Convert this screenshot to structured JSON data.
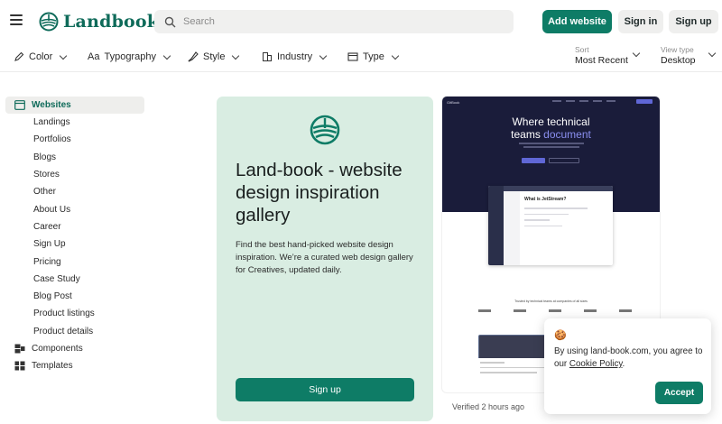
{
  "header": {
    "logo_text": "Landbook",
    "search_placeholder": "Search",
    "add_website_label": "Add website",
    "sign_in_label": "Sign in",
    "sign_up_label": "Sign up"
  },
  "filters": {
    "items": [
      {
        "label": "Color",
        "icon": "pen-icon"
      },
      {
        "label": "Typography",
        "icon": "typography-icon"
      },
      {
        "label": "Style",
        "icon": "brush-icon"
      },
      {
        "label": "Industry",
        "icon": "building-icon"
      },
      {
        "label": "Type",
        "icon": "window-icon"
      }
    ],
    "sort_label": "Sort",
    "sort_value": "Most Recent",
    "view_label": "View type",
    "view_value": "Desktop"
  },
  "sidebar": {
    "active": "Websites",
    "sub_items": [
      "Landings",
      "Portfolios",
      "Blogs",
      "Stores",
      "Other",
      "About Us",
      "Career",
      "Sign Up",
      "Pricing",
      "Case Study",
      "Blog Post",
      "Product listings",
      "Product details"
    ],
    "components_label": "Components",
    "templates_label": "Templates"
  },
  "hero": {
    "title": "Land-book - website design inspiration gallery",
    "description": "Find the best hand-picked website design inspiration. We’re a curated web design gallery for Creatives, updated daily.",
    "signup_label": "Sign up"
  },
  "preview": {
    "brand": "GitBook",
    "headline_1": "Where technical",
    "headline_2a": "teams ",
    "headline_2b": "document",
    "app_title": "What is JetStream?",
    "trusted": "Trusted by technical teams at companies of all sizes",
    "verified": "Verified 2 hours ago"
  },
  "cookie": {
    "emoji": "🍪",
    "text_before": "By using land-book.com, you agree to our ",
    "link": "Cookie Policy",
    "text_after": ".",
    "accept_label": "Accept"
  },
  "colors": {
    "brand_green": "#0e7c66",
    "hero_bg": "#d9ede2",
    "preview_dark": "#1a1c3a",
    "accent_purple": "#8a8ff0"
  }
}
